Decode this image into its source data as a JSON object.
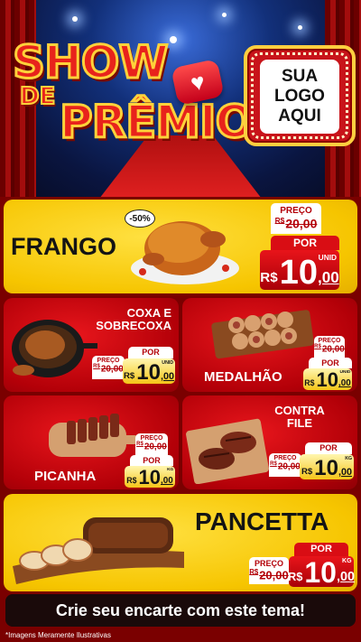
{
  "header": {
    "title_line1": "SHOW",
    "title_line2": "DE",
    "title_line3": "PRÊMIOS",
    "heart_icon": "heart-icon",
    "logo_line1": "SUA",
    "logo_line2": "LOGO",
    "logo_line3": "AQUI"
  },
  "products": {
    "frango": {
      "name": "FRANGO",
      "discount": "-50%",
      "preco_label": "PREÇO",
      "old_currency": "R$",
      "old_price": "20,00",
      "por_label": "POR",
      "currency": "R$",
      "price_int": "10",
      "price_dec": ",00",
      "unit": "UNID"
    },
    "coxa": {
      "name_line1": "COXA E",
      "name_line2": "SOBRECOXA",
      "preco_label": "PREÇO",
      "old_currency": "R$",
      "old_price": "20,00",
      "por_label": "POR",
      "currency": "R$",
      "price_int": "10",
      "price_dec": ",00",
      "unit": "UNID"
    },
    "medalhao": {
      "name": "MEDALHÃO",
      "preco_label": "PREÇO",
      "old_currency": "R$",
      "old_price": "20,00",
      "por_label": "POR",
      "currency": "R$",
      "price_int": "10",
      "price_dec": ",00",
      "unit": "UNID"
    },
    "picanha": {
      "name": "PICANHA",
      "preco_label": "PREÇO",
      "old_currency": "R$",
      "old_price": "20,00",
      "por_label": "POR",
      "currency": "R$",
      "price_int": "10",
      "price_dec": ",00",
      "unit": "KG"
    },
    "contrafile": {
      "name_line1": "CONTRA",
      "name_line2": "FILE",
      "preco_label": "PREÇO",
      "old_currency": "R$",
      "old_price": "20,00",
      "por_label": "POR",
      "currency": "R$",
      "price_int": "10",
      "price_dec": ",00",
      "unit": "KG"
    },
    "pancetta": {
      "name": "PANCETTA",
      "preco_label": "PREÇO",
      "old_currency": "R$",
      "old_price": "20,00",
      "por_label": "POR",
      "currency": "R$",
      "price_int": "10",
      "price_dec": ",00",
      "unit": "KG"
    }
  },
  "footer": {
    "cta": "Crie seu encarte com este tema!",
    "disclaimer": "*Imagens Meramente Ilustrativas"
  },
  "colors": {
    "red": "#d90d14",
    "yellow": "#f6c500",
    "gold": "#ffd23a"
  }
}
